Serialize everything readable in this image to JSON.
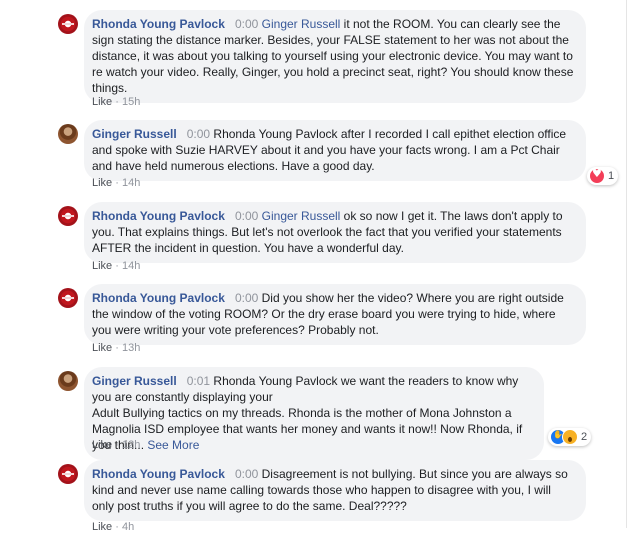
{
  "comments": [
    {
      "author": "Rhonda Young Pavlock",
      "timestamp": "0:00",
      "mention": "Ginger Russell",
      "text": " it not the ROOM. You can clearly see the sign stating the distance marker. Besides, your FALSE statement to her was not about the distance, it was about you talking to yourself using your electronic device. You may want to re watch your video. Really, Ginger, you hold a precinct seat, right? You should know these things.",
      "like_label": "Like",
      "time": "15h"
    },
    {
      "author": "Ginger Russell",
      "timestamp": "0:00",
      "mention": "",
      "text": "Rhonda Young Pavlock after I recorded I call epithet election office and spoke with Suzie HARVEY about it and you have your facts wrong. I am a Pct Chair and have held numerous elections. Have a good day.",
      "like_label": "Like",
      "time": "14h",
      "reaction_count": "1",
      "reaction_icon": "love-reaction-icon"
    },
    {
      "author": "Rhonda Young Pavlock",
      "timestamp": "0:00",
      "mention": "Ginger Russell",
      "text": " ok so now I get it. The laws don't apply to you. That explains things. But let's not overlook the fact that you verified your statements AFTER the incident in question. You have a wonderful day.",
      "like_label": "Like",
      "time": "14h"
    },
    {
      "author": "Rhonda Young Pavlock",
      "timestamp": "0:00",
      "mention": "",
      "text": "Did you show her the video? Where you are right outside the window of the voting ROOM? Or the dry erase board you were trying to hide, where you were writing your vote preferences? Probably not.",
      "like_label": "Like",
      "time": "13h"
    },
    {
      "author": "Ginger Russell",
      "timestamp": "0:01",
      "mention": "",
      "text_line1": "Rhonda Young Pavlock we want the readers to know why you are constantly displaying your",
      "text_line2": "Adult Bullying tactics on my threads. Rhonda is the mother of Mona Johnston a Magnolia ISD employee that wants her money and wants it now!! Now Rhonda, if you thin...",
      "see_more": "See More",
      "like_label": "Like",
      "time": "12h",
      "reaction_count": "2",
      "reaction_icons": [
        "like-reaction-icon",
        "wow-reaction-icon"
      ]
    },
    {
      "author": "Rhonda Young Pavlock",
      "timestamp": "0:00",
      "mention": "",
      "text": "Disagreement is not bullying. But since you are always so kind and never use name calling towards those who happen to disagree with you, I will only post truths if you will agree to do the same. Deal?????",
      "like_label": "Like",
      "time": "4h"
    }
  ],
  "separator": "·"
}
